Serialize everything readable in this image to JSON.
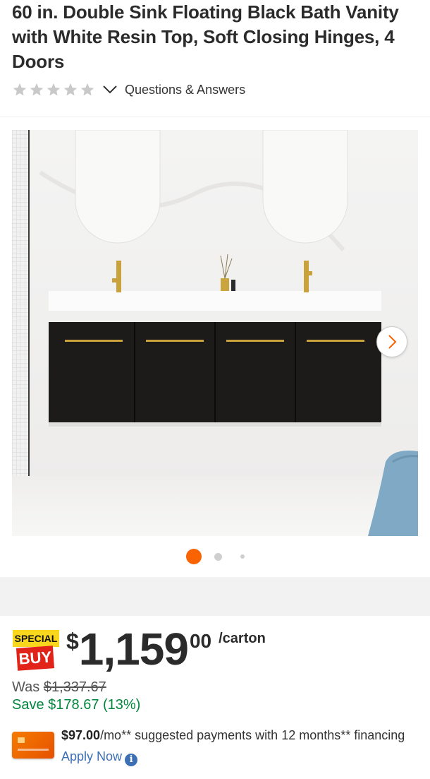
{
  "product": {
    "title": "60 in. Double Sink Floating Black Bath Vanity with White Resin Top, Soft Closing Hinges, 4 Doors",
    "questions_label": "Questions & Answers"
  },
  "rating": {
    "stars_filled": 0,
    "stars_total": 5
  },
  "icons": {
    "star": "star-outline-icon",
    "chevron": "chevron-down-icon",
    "next": "chevron-right-icon",
    "info": "info-icon",
    "card": "credit-card-icon"
  },
  "gallery": {
    "active_index": 1,
    "dot_count": 3
  },
  "badge": {
    "top": "SPECIAL",
    "bottom": "BUY"
  },
  "price": {
    "dollar_sign": "$",
    "main": "1,159",
    "cents": "00",
    "unit": "/carton",
    "was_label": "Was ",
    "was_value": "$1,337.67",
    "save": "Save $178.67 (13%)"
  },
  "financing": {
    "amount": "$97.00",
    "text": "/mo** suggested payments with 12 months** financing ",
    "link": "Apply Now",
    "info_glyph": "i"
  },
  "colors": {
    "accent": "#f96302",
    "save_green": "#00873c",
    "link_blue": "#3d6fb5",
    "special_yellow": "#f9d71c",
    "buy_red": "#e2231a"
  }
}
